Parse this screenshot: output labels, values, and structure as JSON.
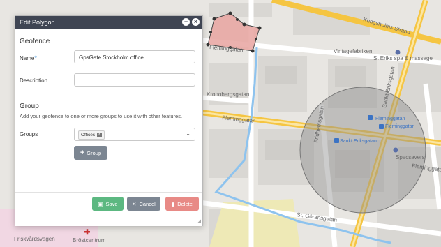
{
  "dialog": {
    "title": "Edit Polygon",
    "minimize_icon": "minimize-icon",
    "close_icon": "close-icon",
    "geofence_heading": "Geofence",
    "name_label": "Name",
    "name_required_marker": "*",
    "name_value": "GpsGate Stockholm office",
    "description_label": "Description",
    "description_value": "",
    "group_heading": "Group",
    "group_hint": "Add your geofence to one or more groups to use it with other features.",
    "groups_label": "Groups",
    "groups_selected": [
      "Offices"
    ],
    "add_group_label": "Group",
    "save_label": "Save",
    "cancel_label": "Cancel",
    "delete_label": "Delete",
    "colors": {
      "titlebar": "#3f4553",
      "save": "#5cb881",
      "cancel": "#7c8692",
      "delete": "#e88a86",
      "required": "#3b8fd6"
    }
  },
  "map": {
    "street_labels": [
      "Kungsholms Strand",
      "Fleminggatan",
      "Fleminggatan",
      "Fleminggatan",
      "Fridhemsgatan",
      "Sankt Eriksgatan",
      "St. Göransgatan",
      "Kronobergsgatan",
      "Friskvårdsvägen"
    ],
    "poi_labels": [
      "Vintagefabriken",
      "St Eriks spa & massage",
      "Fleminggatan",
      "Fleminggatan",
      "Sankt Eriksgatan",
      "Specsavers",
      "Bröstcentrum"
    ],
    "colors": {
      "background": "#e9e7e3",
      "road_major": "#f5c542",
      "route": "#8ec3ee",
      "polygon_fill": "#e7a3a0",
      "circle_fill": "#9a9a9a"
    }
  }
}
